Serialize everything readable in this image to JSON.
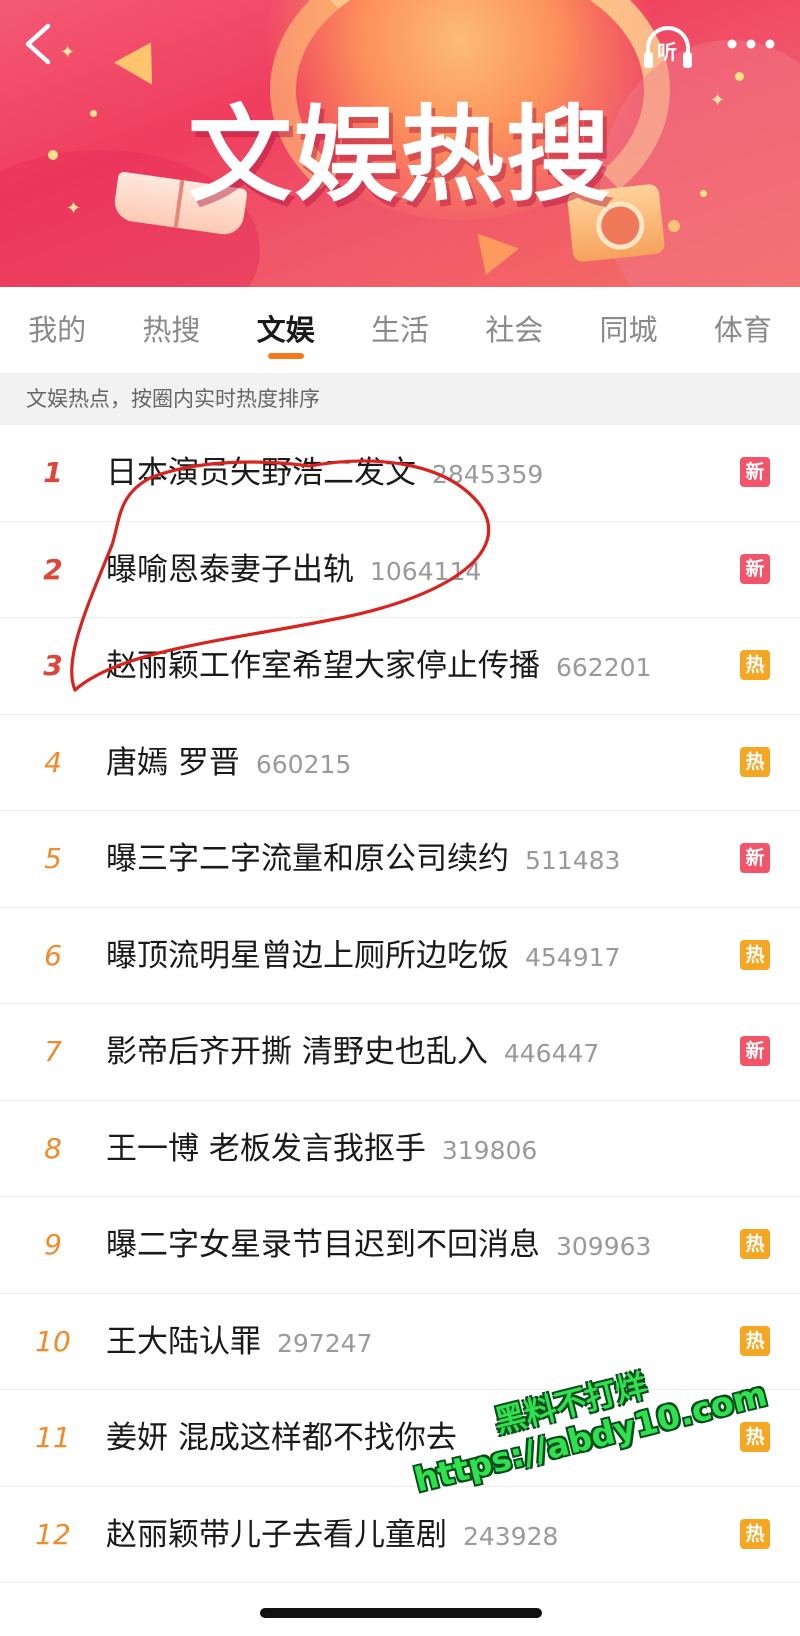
{
  "header": {
    "title": "文娱热搜",
    "listen_label": "听",
    "colors": {
      "banner": "#ef3d5e",
      "accent": "#f27b1f"
    }
  },
  "tabs": [
    {
      "label": "我的",
      "active": false
    },
    {
      "label": "热搜",
      "active": false
    },
    {
      "label": "文娱",
      "active": true
    },
    {
      "label": "生活",
      "active": false
    },
    {
      "label": "社会",
      "active": false
    },
    {
      "label": "同城",
      "active": false
    },
    {
      "label": "体育",
      "active": false
    }
  ],
  "subtitle": "文娱热点，按圈内实时热度排序",
  "items": [
    {
      "rank": "1",
      "title": "日本演员矢野浩二发文",
      "heat": "2845359",
      "badge": "新"
    },
    {
      "rank": "2",
      "title": "曝喻恩泰妻子出轨",
      "heat": "1064114",
      "badge": "新"
    },
    {
      "rank": "3",
      "title": "赵丽颖工作室希望大家停止传播",
      "heat": "662201",
      "badge": "热"
    },
    {
      "rank": "4",
      "title": "唐嫣 罗晋",
      "heat": "660215",
      "badge": "热"
    },
    {
      "rank": "5",
      "title": "曝三字二字流量和原公司续约",
      "heat": "511483",
      "badge": "新"
    },
    {
      "rank": "6",
      "title": "曝顶流明星曾边上厕所边吃饭",
      "heat": "454917",
      "badge": "热"
    },
    {
      "rank": "7",
      "title": "影帝后齐开撕 清野史也乱入",
      "heat": "446447",
      "badge": "新"
    },
    {
      "rank": "8",
      "title": "王一博 老板发言我抠手",
      "heat": "319806",
      "badge": ""
    },
    {
      "rank": "9",
      "title": "曝二字女星录节目迟到不回消息",
      "heat": "309963",
      "badge": "热"
    },
    {
      "rank": "10",
      "title": "王大陆认罪",
      "heat": "297247",
      "badge": "热"
    },
    {
      "rank": "11",
      "title": "姜妍 混成这样都不找你去",
      "heat": "",
      "badge": "热"
    },
    {
      "rank": "12",
      "title": "赵丽颖带儿子去看儿童剧",
      "heat": "243928",
      "badge": "热"
    }
  ],
  "badge_colors": {
    "新": "#f2556a",
    "热": "#f5a623"
  },
  "watermark": {
    "line1": "黑料不打烊",
    "line2": "https://abdy10.com"
  }
}
